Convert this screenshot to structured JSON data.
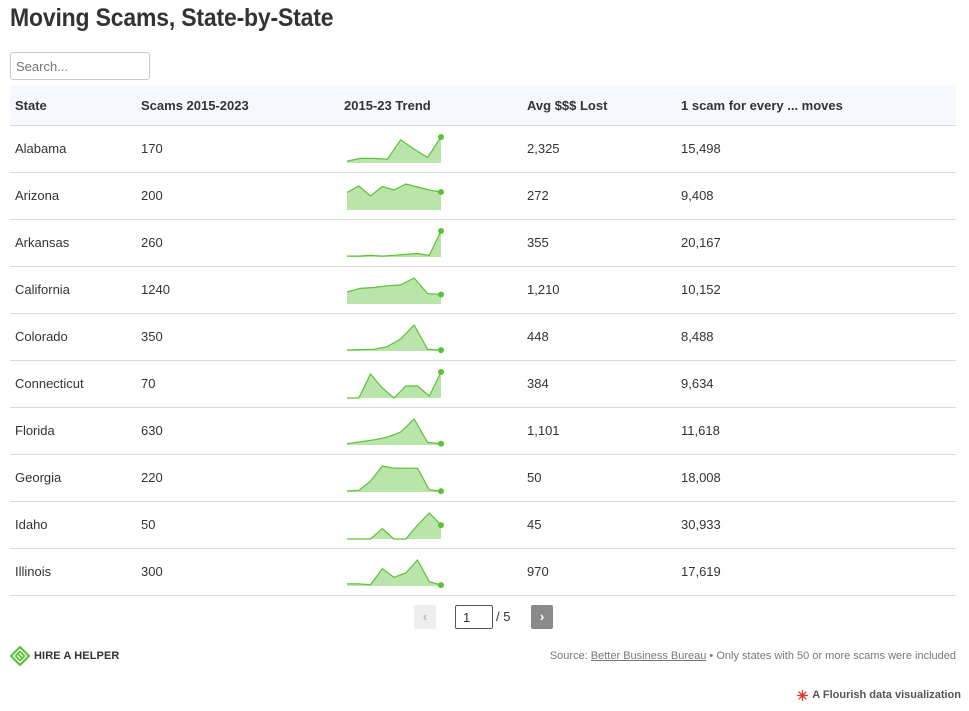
{
  "title": "Moving Scams, State-by-State",
  "search": {
    "placeholder": "Search..."
  },
  "columns": [
    "State",
    "Scams 2015-2023",
    "2015-23 Trend",
    "Avg $$$ Lost",
    "1 scam for every ... moves"
  ],
  "chart_data": {
    "type": "table",
    "title": "Moving Scams, State-by-State",
    "sparkline_color": "#5bc236",
    "sparkline_fill": "#b9e4aa",
    "rows": [
      {
        "state": "Alabama",
        "scams": "170",
        "trend": [
          2,
          5,
          5,
          4,
          25,
          15,
          6,
          28
        ],
        "avg_lost": "2,325",
        "one_in": "15,498"
      },
      {
        "state": "Arizona",
        "scams": "200",
        "trend": [
          35,
          48,
          28,
          47,
          40,
          52,
          46,
          40,
          36
        ],
        "avg_lost": "272",
        "one_in": "9,408"
      },
      {
        "state": "Arkansas",
        "scams": "260",
        "trend": [
          1,
          1,
          2,
          1,
          2,
          3,
          4,
          2,
          30
        ],
        "avg_lost": "355",
        "one_in": "20,167"
      },
      {
        "state": "California",
        "scams": "1240",
        "trend": [
          140,
          180,
          190,
          210,
          220,
          300,
          120,
          110
        ],
        "avg_lost": "1,210",
        "one_in": "10,152"
      },
      {
        "state": "Colorado",
        "scams": "350",
        "trend": [
          5,
          8,
          10,
          25,
          70,
          150,
          10,
          5
        ],
        "avg_lost": "448",
        "one_in": "8,488"
      },
      {
        "state": "Connecticut",
        "scams": "70",
        "trend": [
          0,
          0,
          12,
          5,
          0,
          6,
          6,
          1,
          13
        ],
        "avg_lost": "384",
        "one_in": "9,634"
      },
      {
        "state": "Florida",
        "scams": "630",
        "trend": [
          10,
          25,
          40,
          60,
          100,
          200,
          20,
          10
        ],
        "avg_lost": "1,101",
        "one_in": "11,618"
      },
      {
        "state": "Georgia",
        "scams": "220",
        "trend": [
          2,
          4,
          25,
          60,
          55,
          55,
          55,
          5,
          2
        ],
        "avg_lost": "50",
        "one_in": "18,008"
      },
      {
        "state": "Idaho",
        "scams": "50",
        "trend": [
          0,
          0,
          0,
          6,
          0,
          0,
          8,
          15,
          8
        ],
        "avg_lost": "45",
        "one_in": "30,933"
      },
      {
        "state": "Illinois",
        "scams": "300",
        "trend": [
          5,
          5,
          3,
          40,
          20,
          30,
          60,
          10,
          2
        ],
        "avg_lost": "970",
        "one_in": "17,619"
      }
    ]
  },
  "pagination": {
    "prev": "‹",
    "next": "›",
    "current": "1",
    "total": "/ 5"
  },
  "logo": {
    "text": "HIRE A HELPER",
    "icon": "hire-a-helper-logo-icon",
    "color": "#5bc236"
  },
  "source": {
    "prefix": "Source: ",
    "link": "Better Business Bureau",
    "suffix": " • Only states with 50 or more scams were included"
  },
  "flourish": {
    "text": "A Flourish data visualization",
    "icon": "flourish-star-icon",
    "color": "#e8362d"
  }
}
